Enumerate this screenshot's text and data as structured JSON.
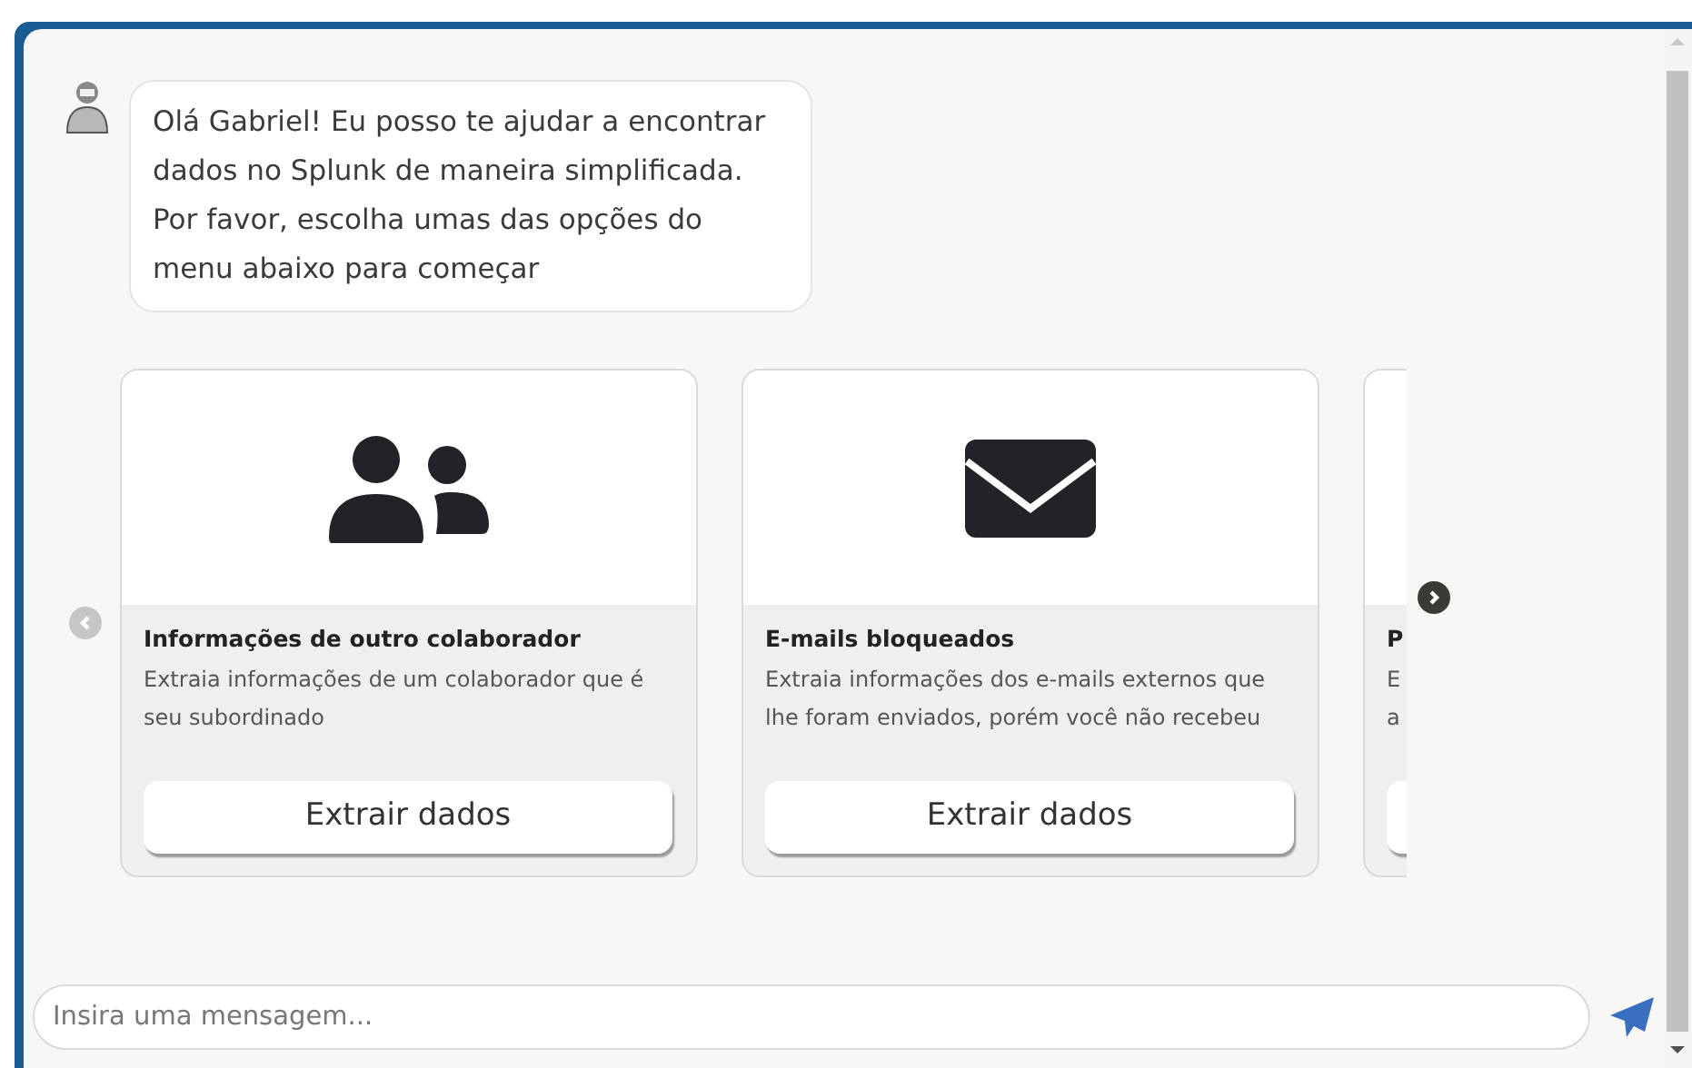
{
  "message": {
    "text": "Olá Gabriel! Eu posso te ajudar a encontrar dados no Splunk de maneira simplificada. Por favor, escolha umas das opções do menu abaixo para começar"
  },
  "carousel": {
    "prev_disabled": true,
    "next_disabled": false,
    "cards": [
      {
        "kind": "people",
        "title": "Informações de outro colaborador",
        "description": "Extraia informações de um colaborador que é seu subordinado",
        "button": "Extrair dados"
      },
      {
        "kind": "envelope",
        "title": "E-mails bloqueados",
        "description": "Extraia informações dos e-mails externos que lhe foram enviados, porém você não recebeu",
        "button": "Extrair dados"
      },
      {
        "kind": "partial",
        "title": "P",
        "description_lines": [
          "E",
          "a"
        ]
      }
    ]
  },
  "composer": {
    "placeholder": "Insira uma mensagem..."
  }
}
